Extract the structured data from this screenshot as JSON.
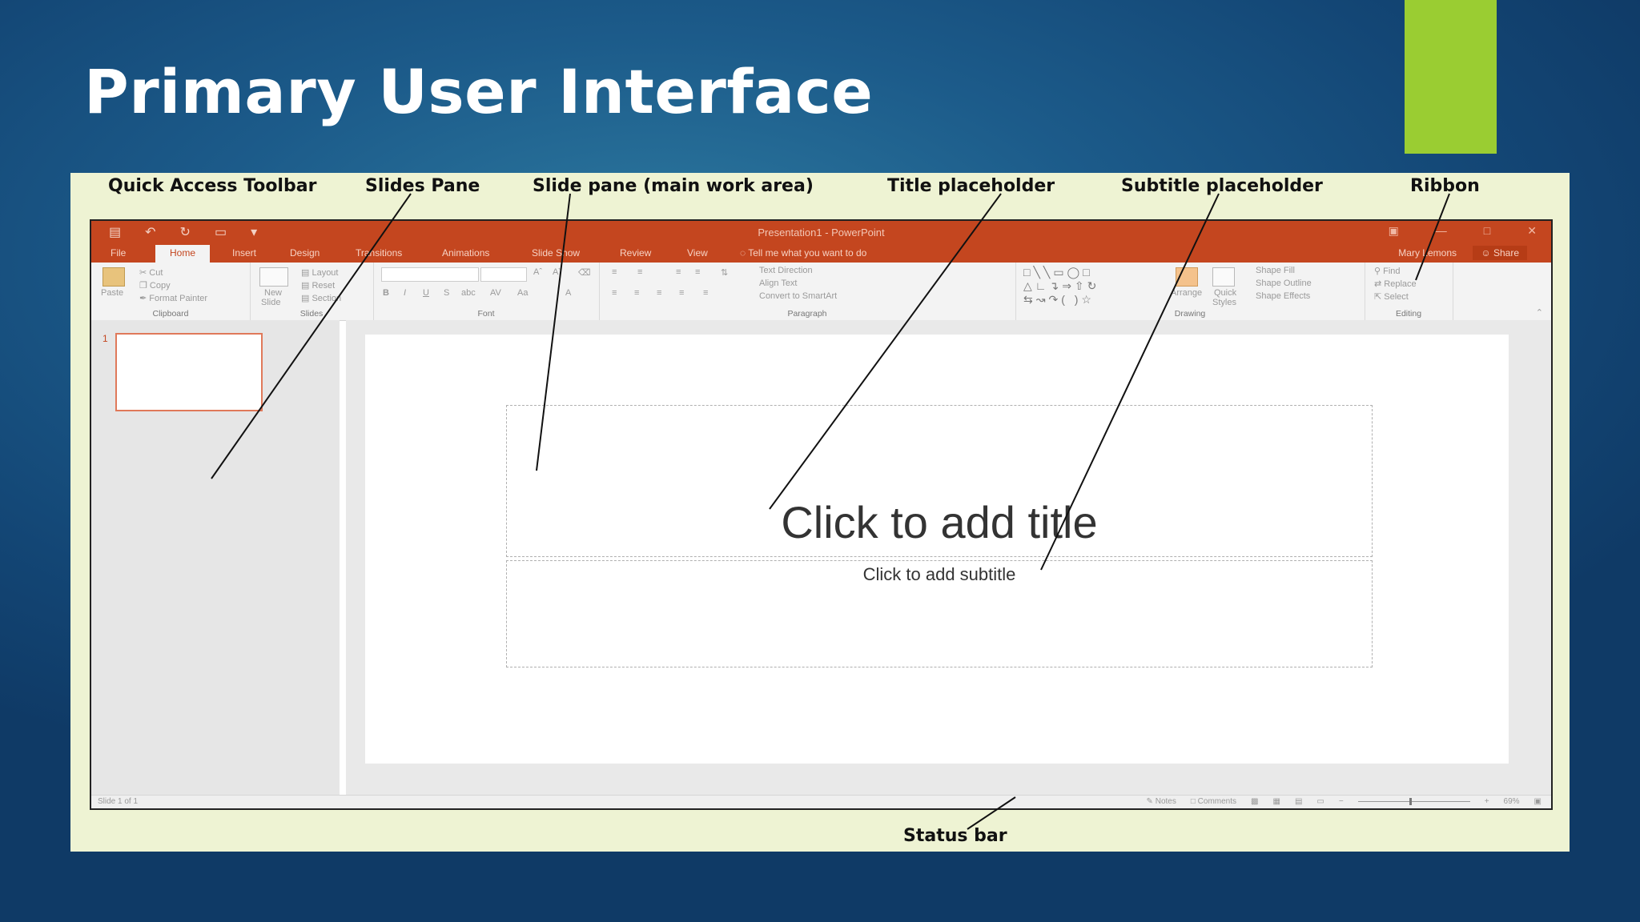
{
  "slide": {
    "title": "Primary User Interface",
    "accent_color": "#9acd32",
    "background": "#1c5b8a"
  },
  "callouts": {
    "quick_access_toolbar": "Quick Access Toolbar",
    "slides_pane": "Slides Pane",
    "slide_pane_main": "Slide pane (main work area)",
    "title_placeholder": "Title placeholder",
    "subtitle_placeholder": "Subtitle placeholder",
    "ribbon": "Ribbon",
    "status_bar": "Status bar"
  },
  "window": {
    "doc_title": "Presentation1 - PowerPoint",
    "accent": "#c4461f",
    "qat_icons": [
      "save-icon",
      "undo-icon",
      "redo-icon",
      "start-from-beginning-icon",
      "customize-qat-icon"
    ]
  },
  "tabs": [
    "File",
    "Home",
    "Insert",
    "Design",
    "Transitions",
    "Animations",
    "Slide Show",
    "Review",
    "View"
  ],
  "tell_me": "Tell me what you want to do",
  "user_name": "Mary Lemons",
  "share": "Share",
  "ribbon": {
    "clipboard": {
      "name": "Clipboard",
      "paste": "Paste",
      "cut": "Cut",
      "copy": "Copy",
      "format_painter": "Format Painter"
    },
    "slides": {
      "name": "Slides",
      "new_slide": "New",
      "new_slide_2": "Slide",
      "layout": "Layout",
      "reset": "Reset",
      "section": "Section"
    },
    "font": {
      "name": "Font"
    },
    "paragraph": {
      "name": "Paragraph",
      "text_direction": "Text Direction",
      "align_text": "Align Text",
      "smartart": "Convert to SmartArt"
    },
    "drawing": {
      "name": "Drawing",
      "arrange": "Arrange",
      "quick_styles": "Quick",
      "quick_styles_2": "Styles",
      "shape_fill": "Shape Fill",
      "shape_outline": "Shape Outline",
      "shape_effects": "Shape Effects"
    },
    "editing": {
      "name": "Editing",
      "find": "Find",
      "replace": "Replace",
      "select": "Select"
    }
  },
  "thumbnail": {
    "number": "1"
  },
  "placeholders": {
    "title": "Click to add title",
    "subtitle": "Click to add subtitle"
  },
  "status": {
    "slide_count": "Slide 1 of 1",
    "notes": "Notes",
    "comments": "Comments",
    "zoom": "69%"
  }
}
